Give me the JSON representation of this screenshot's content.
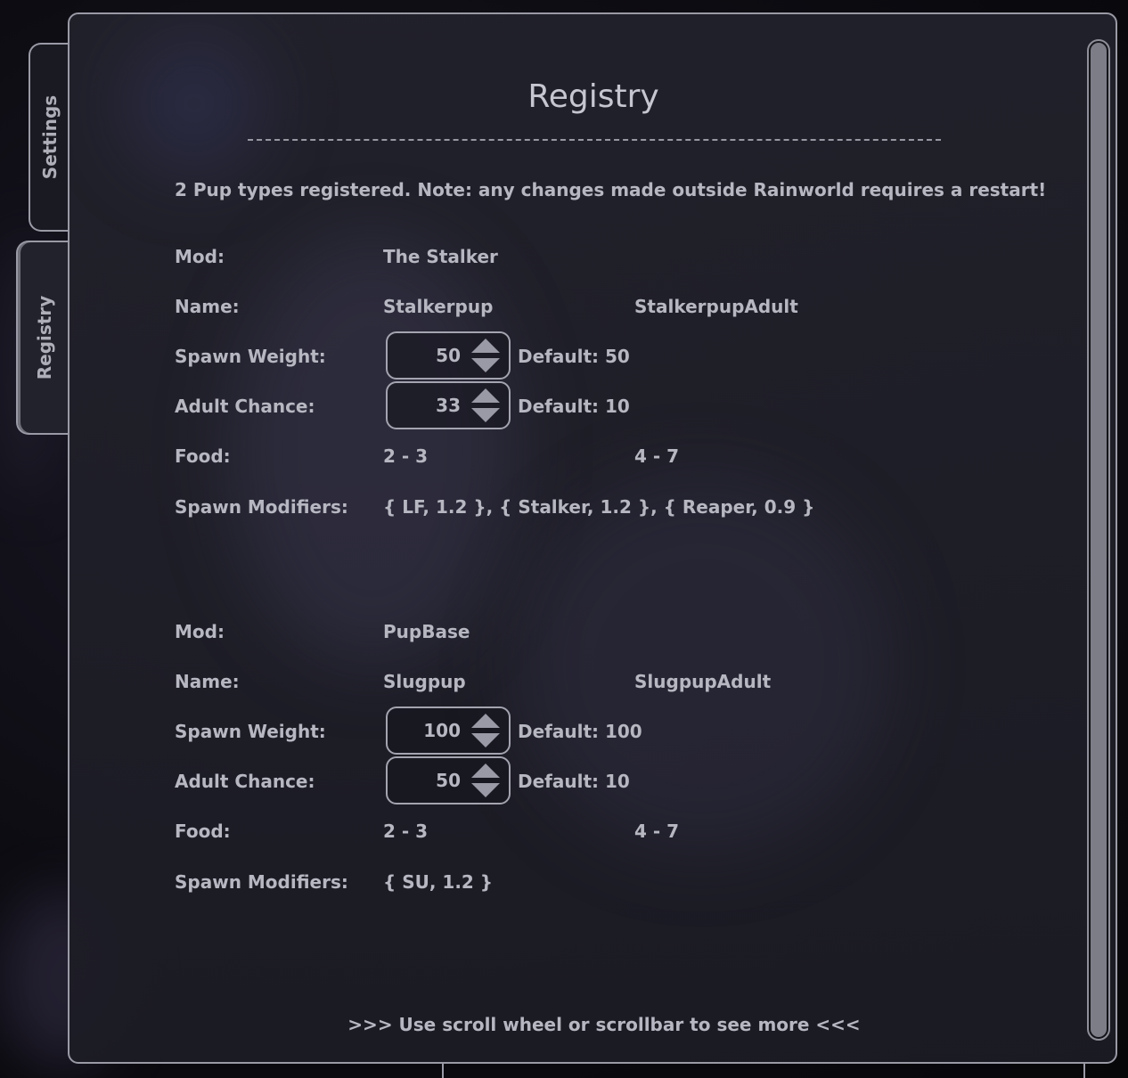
{
  "tabs": [
    {
      "label": "Settings",
      "active": false
    },
    {
      "label": "Registry",
      "active": true
    }
  ],
  "panel": {
    "title": "Registry",
    "divider": "- - - - - - - - - - - - - - - - - - - - - - - - - - - - - - - - - - - - - - - - - - - - - -",
    "note": "2 Pup types registered. Note: any changes made outside Rainworld requires a restart!",
    "footer": ">>> Use scroll wheel or scrollbar to see more <<<"
  },
  "labels": {
    "mod": "Mod:",
    "name": "Name:",
    "spawn_weight": "Spawn Weight:",
    "adult_chance": "Adult Chance:",
    "food": "Food:",
    "spawn_modifiers": "Spawn Modifiers:"
  },
  "pups": [
    {
      "mod": "The Stalker",
      "name": "Stalkerpup",
      "adult_name": "StalkerpupAdult",
      "spawn_weight": "50",
      "spawn_weight_default": "Default: 50",
      "adult_chance": "33",
      "adult_chance_default": "Default: 10",
      "food": "2 - 3",
      "adult_food": "4 - 7",
      "spawn_modifiers": "{ LF, 1.2 }, { Stalker, 1.2 }, { Reaper, 0.9 }"
    },
    {
      "mod": "PupBase",
      "name": "Slugpup",
      "adult_name": "SlugpupAdult",
      "spawn_weight": "100",
      "spawn_weight_default": "Default: 100",
      "adult_chance": "50",
      "adult_chance_default": "Default: 10",
      "food": "2 - 3",
      "adult_food": "4 - 7",
      "spawn_modifiers": "{ SU, 1.2 }"
    }
  ],
  "colors": {
    "panel_border": "#9a9aa6",
    "text": "#b7b7c2",
    "panel_bg": "#22222c"
  },
  "icons": {
    "increment": "triangle-up",
    "decrement": "triangle-down"
  }
}
